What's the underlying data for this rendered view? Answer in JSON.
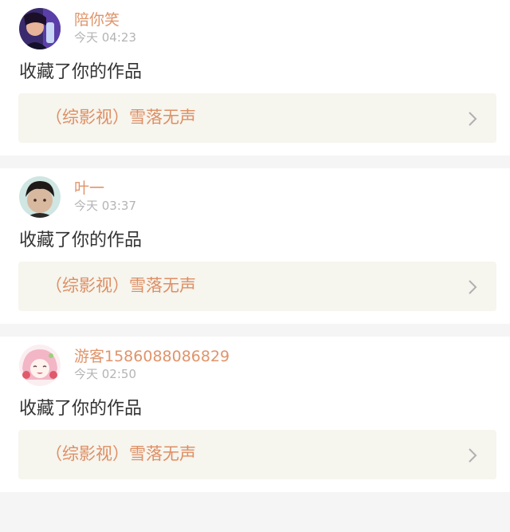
{
  "notifications": [
    {
      "username": "陪你笑",
      "time": "今天 04:23",
      "action": "收藏了你的作品",
      "work_title": "（综影视）雪落无声",
      "icons": {
        "avatar": "user-avatar",
        "chevron": "chevron-right-icon"
      }
    },
    {
      "username": "叶一",
      "time": "今天 03:37",
      "action": "收藏了你的作品",
      "work_title": "（综影视）雪落无声",
      "icons": {
        "avatar": "user-avatar",
        "chevron": "chevron-right-icon"
      }
    },
    {
      "username": "游客1586088086829",
      "time": "今天 02:50",
      "action": "收藏了你的作品",
      "work_title": "（综影视）雪落无声",
      "icons": {
        "avatar": "user-avatar",
        "chevron": "chevron-right-icon"
      }
    }
  ],
  "colors": {
    "username": "#e0946a",
    "timestamp": "#b4b4b4",
    "work_title": "#de8e63",
    "work_link_background": "#f6f5ee",
    "page_background": "#f5f5f5"
  }
}
